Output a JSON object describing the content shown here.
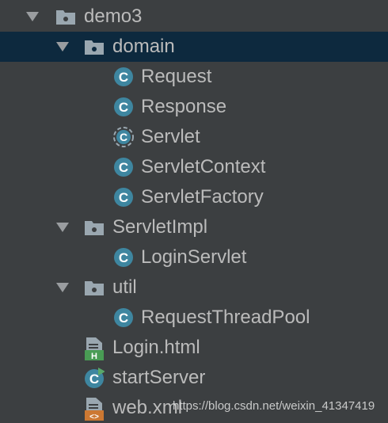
{
  "tree": {
    "items": [
      {
        "label": "demo3",
        "icon": "folder-icon",
        "expanded": true
      },
      {
        "label": "domain",
        "icon": "folder-icon",
        "expanded": true,
        "selected": true
      },
      {
        "label": "Request",
        "icon": "class-icon"
      },
      {
        "label": "Response",
        "icon": "class-icon"
      },
      {
        "label": "Servlet",
        "icon": "abstract-class-icon"
      },
      {
        "label": "ServletContext",
        "icon": "class-icon"
      },
      {
        "label": "ServletFactory",
        "icon": "class-icon"
      },
      {
        "label": "ServletImpl",
        "icon": "folder-icon",
        "expanded": true
      },
      {
        "label": "LoginServlet",
        "icon": "class-icon"
      },
      {
        "label": "util",
        "icon": "folder-icon",
        "expanded": true
      },
      {
        "label": "RequestThreadPool",
        "icon": "class-icon"
      },
      {
        "label": "Login.html",
        "icon": "html-file-icon"
      },
      {
        "label": "startServer",
        "icon": "runnable-class-icon"
      },
      {
        "label": "web.xml",
        "icon": "xml-file-icon"
      }
    ]
  },
  "watermark": "https://blog.csdn.net/weixin_41347419",
  "colors": {
    "background": "#3c3f41",
    "selection": "#0d293e",
    "text": "#bbbbbb",
    "folder": "#9aa7b0",
    "class": "#3e86a0",
    "html_green": "#499c54",
    "xml_orange": "#cc7832"
  }
}
